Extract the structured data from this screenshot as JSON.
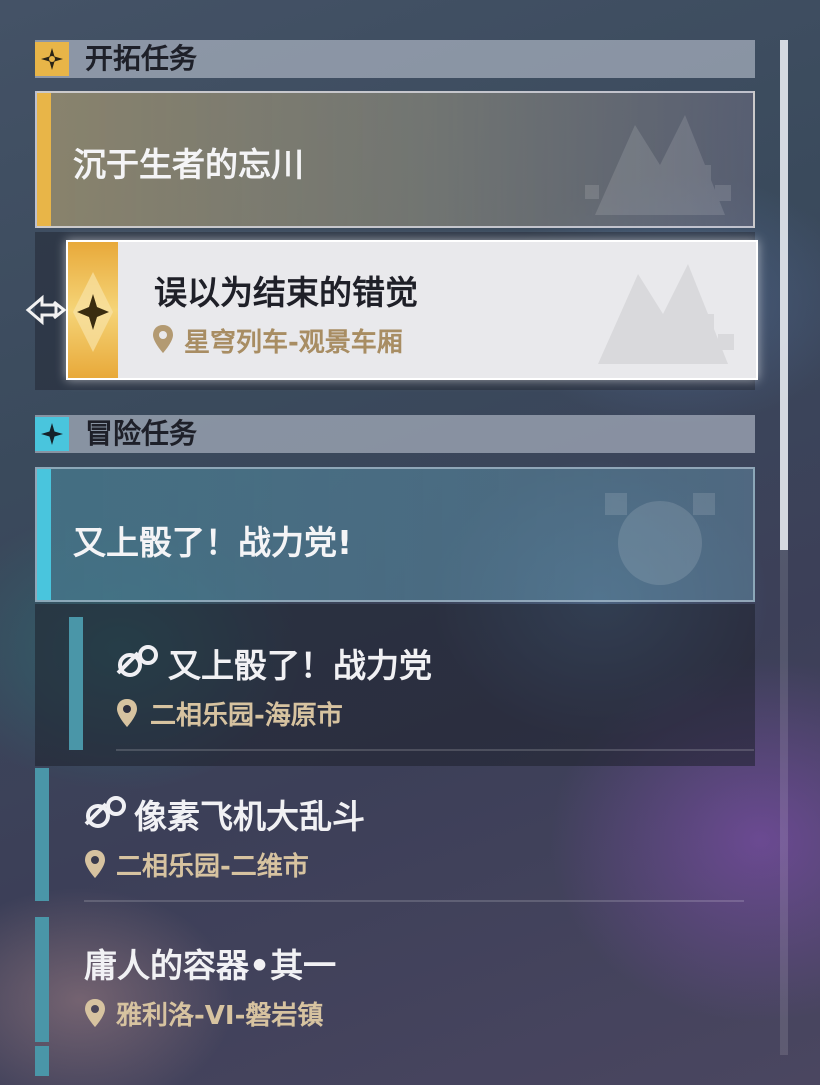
{
  "sections": {
    "trailblaze": {
      "title": "开拓任务",
      "icon": "trailblaze-star-icon",
      "main_quest": {
        "title": "沉于生者的忘川"
      },
      "sub_quest": {
        "title": "误以为结束的错觉",
        "location": "星穹列车-观景车厢"
      }
    },
    "adventure": {
      "title": "冒险任务",
      "icon": "adventure-star-icon",
      "group": {
        "title": "又上骰了！战力党!"
      },
      "quests": [
        {
          "title": "又上骰了！战力党",
          "location": "二相乐园-海原市",
          "icon": "event-icon"
        },
        {
          "title": "像素飞机大乱斗",
          "location": "二相乐园-二维市",
          "icon": "event-icon"
        },
        {
          "title": "庸人的容器•其一",
          "location": "雅利洛-VI-磐岩镇"
        }
      ]
    }
  },
  "colors": {
    "gold_accent": "#e8b548",
    "cyan_accent": "#49c5dd",
    "teal_accent": "#4a96a8",
    "location_text": "#d7c3a0"
  }
}
